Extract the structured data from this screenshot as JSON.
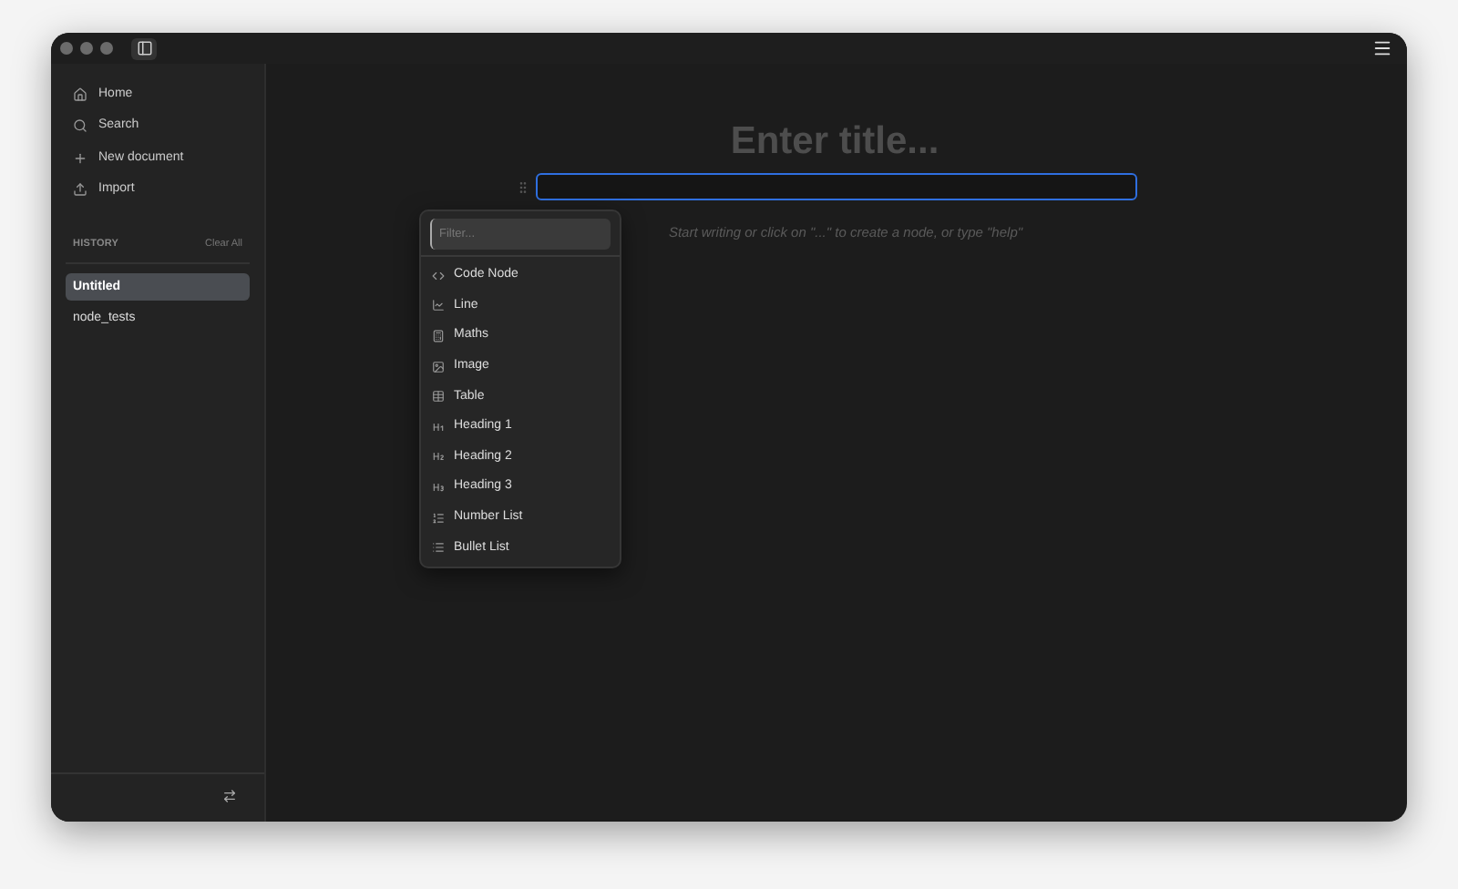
{
  "sidebar": {
    "nav": [
      {
        "label": "Home",
        "kind": "home"
      },
      {
        "label": "Search",
        "kind": "search"
      },
      {
        "label": "New document",
        "kind": "new"
      },
      {
        "label": "Import",
        "kind": "import"
      }
    ],
    "history": {
      "title": "HISTORY",
      "clear": "Clear All",
      "items": [
        {
          "label": "Untitled",
          "selected": true
        },
        {
          "label": "node_tests",
          "selected": false
        }
      ]
    }
  },
  "editor": {
    "title_placeholder": "Enter title...",
    "hint": "Start writing or click on \"...\" to create a node, or type \"help\""
  },
  "node_menu": {
    "filter_placeholder": "Filter...",
    "items": [
      {
        "label": "Code Node",
        "kind": "code"
      },
      {
        "label": "Line",
        "kind": "line"
      },
      {
        "label": "Maths",
        "kind": "maths"
      },
      {
        "label": "Image",
        "kind": "image"
      },
      {
        "label": "Table",
        "kind": "table"
      },
      {
        "label": "Heading 1",
        "kind": "h1"
      },
      {
        "label": "Heading 2",
        "kind": "h2"
      },
      {
        "label": "Heading 3",
        "kind": "h3"
      },
      {
        "label": "Number List",
        "kind": "olist"
      },
      {
        "label": "Bullet List",
        "kind": "ulist"
      }
    ]
  }
}
